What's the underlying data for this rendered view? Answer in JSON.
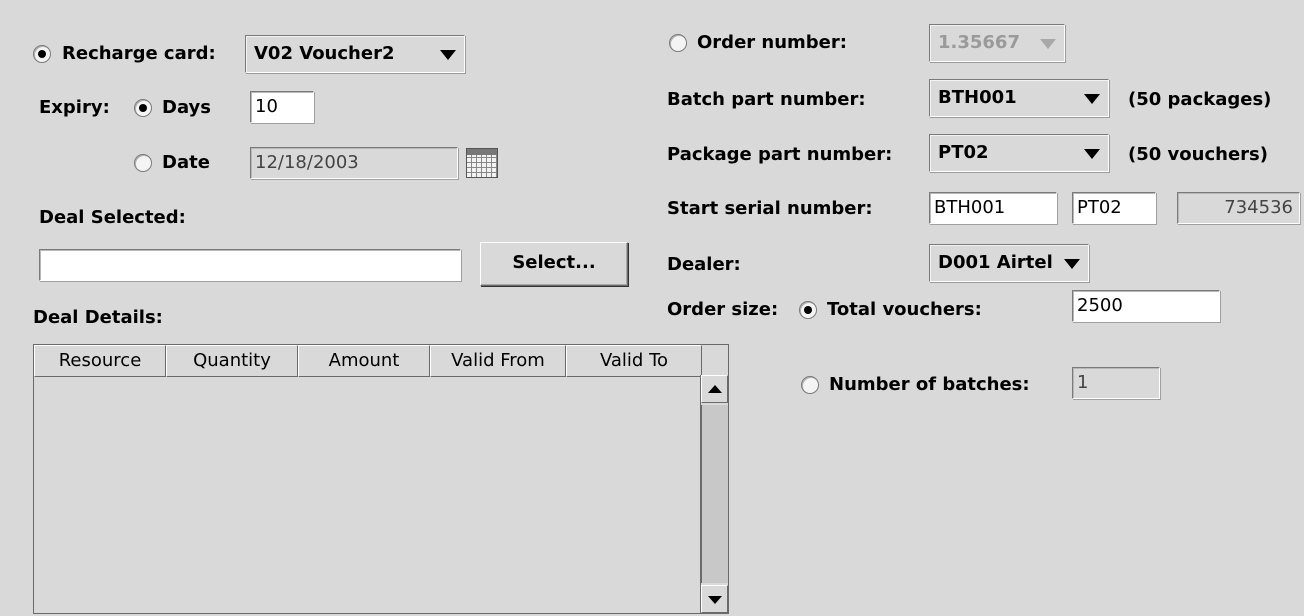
{
  "left": {
    "recharge_card": {
      "label": "Recharge card:",
      "value": "V02  Voucher2",
      "checked": true
    },
    "expiry": {
      "label": "Expiry:",
      "days_label": "Days",
      "days_value": "10",
      "date_label": "Date",
      "date_value": "12/18/2003"
    },
    "deal_selected": {
      "label": "Deal Selected:",
      "value": "",
      "select_button": "Select..."
    },
    "deal_details": {
      "label": "Deal Details:",
      "columns": [
        "Resource",
        "Quantity",
        "Amount",
        "Valid From",
        "Valid To"
      ],
      "rows": []
    }
  },
  "right": {
    "order_number": {
      "label": "Order number:",
      "value": "1.35667"
    },
    "batch_part": {
      "label": "Batch part number:",
      "value": "BTH001",
      "note": "(50 packages)"
    },
    "package_part": {
      "label": "Package part number:",
      "value": "PT02",
      "note": "(50 vouchers)"
    },
    "start_serial": {
      "label": "Start serial number:",
      "part1": "BTH001",
      "part2": "PT02",
      "part3": "734536"
    },
    "dealer": {
      "label": "Dealer:",
      "value": "D001  Airtel"
    },
    "order_size": {
      "label": "Order size:",
      "total_label": "Total vouchers:",
      "total_value": "2500",
      "batches_label": "Number of batches:",
      "batches_value": "1"
    }
  },
  "icons": {
    "calendar": "calendar-icon",
    "combo_arrow": "chevron-down-icon",
    "scroll_up": "arrow-up-icon",
    "scroll_down": "arrow-down-icon"
  },
  "colors": {
    "background": "#d9d9d9",
    "field": "#ffffff",
    "border": "#7a7a7a"
  }
}
